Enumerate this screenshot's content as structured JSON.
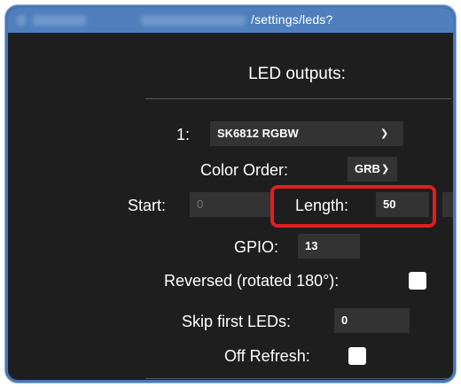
{
  "address_bar": {
    "url_text": "/settings/leds?"
  },
  "page": {
    "heading": "LED outputs:"
  },
  "output1": {
    "index_label": "1:",
    "type_value": "SK6812 RGBW",
    "color_order_label": "Color Order:",
    "color_order_value": "GRB",
    "start_label": "Start:",
    "start_value": "0",
    "length_label": "Length:",
    "length_value": "50",
    "gpio_label": "GPIO:",
    "gpio_value": "13",
    "reversed_label": "Reversed (rotated 180°):",
    "reversed_checked": false,
    "skip_label": "Skip first LEDs:",
    "skip_value": "0",
    "off_refresh_label": "Off Refresh:",
    "off_refresh_checked": false
  },
  "annotation": {
    "highlight_color": "#e01e1e"
  }
}
